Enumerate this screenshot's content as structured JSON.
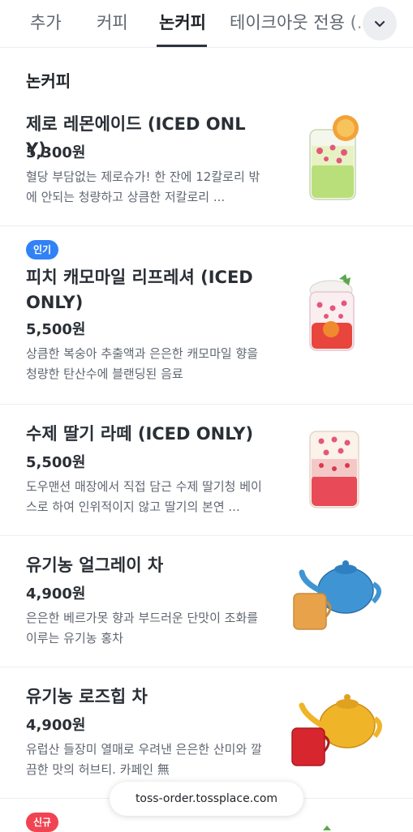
{
  "tabs": [
    {
      "label": "추가"
    },
    {
      "label": "커피"
    },
    {
      "label": "논커피"
    },
    {
      "label": "테이크아웃 전용 (..."
    }
  ],
  "active_tab": "논커피",
  "more_icon": "chevron-down-icon",
  "section": {
    "title": "논커피"
  },
  "items": [
    {
      "badge": "",
      "name": "제로 레몬에이드 (ICED ONLY)",
      "price": "5,300원",
      "desc": "혈당 부담없는 제로슈가! 한 잔에 12칼로리 밖에 안되는 청량하고 상큼한 저칼로리 ..."
    },
    {
      "badge": "인기",
      "badge_color": "#3182f6",
      "name": "피치 캐모마일 리프레셔 (ICED ONLY)",
      "price": "5,500원",
      "desc": "상큼한 복숭아 추출액과 은은한 캐모마일 향을 청량한 탄산수에 블랜딩된 음료"
    },
    {
      "badge": "",
      "name": "수제 딸기 라떼 (ICED ONLY)",
      "price": "5,500원",
      "desc": "도우맨션 매장에서 직접 담근 수제 딸기청 베이스로 하여 인위적이지 않고 딸기의 본연 ..."
    },
    {
      "badge": "",
      "name": "유기농 얼그레이 차",
      "price": "4,900원",
      "desc": "은은한 베르가못 향과 부드러운 단맛이 조화를 이루는 유기농 홍차"
    },
    {
      "badge": "",
      "name": "유기농 로즈힙 차",
      "price": "4,900원",
      "desc": "유럽산 들장미 열매로 우려낸 은은한 산미와 깔끔한 맛의 허브티. 카페인 無"
    },
    {
      "badge": "신규",
      "badge_color": "#f04452",
      "name": "",
      "price": "",
      "desc": ""
    }
  ],
  "url_bar": {
    "text": "toss-order.tossplace.com"
  }
}
